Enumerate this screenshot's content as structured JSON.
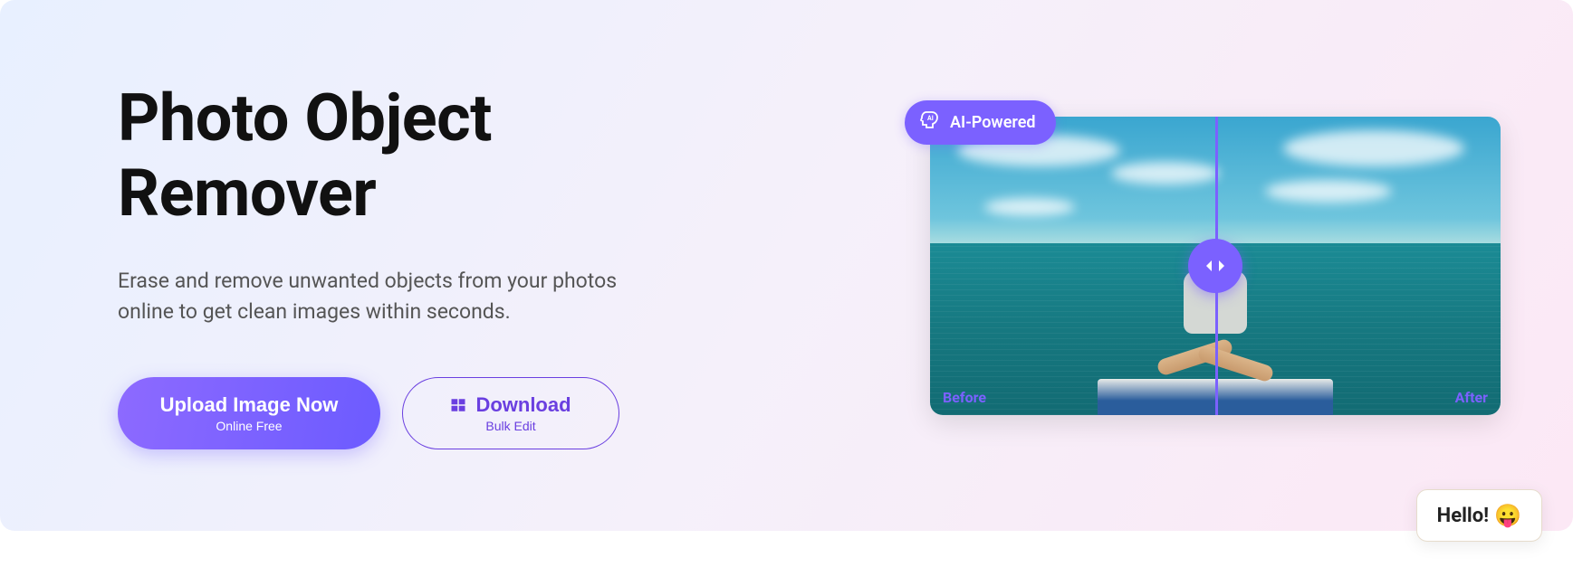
{
  "hero": {
    "title": "Photo Object Remover",
    "description": "Erase and remove unwanted objects from your photos online to get clean images within seconds."
  },
  "buttons": {
    "upload": {
      "main": "Upload Image Now",
      "sub": "Online Free"
    },
    "download": {
      "main": "Download",
      "sub": "Bulk Edit"
    }
  },
  "preview": {
    "badge": "AI-Powered",
    "before_label": "Before",
    "after_label": "After"
  },
  "chat": {
    "greeting": "Hello!"
  }
}
